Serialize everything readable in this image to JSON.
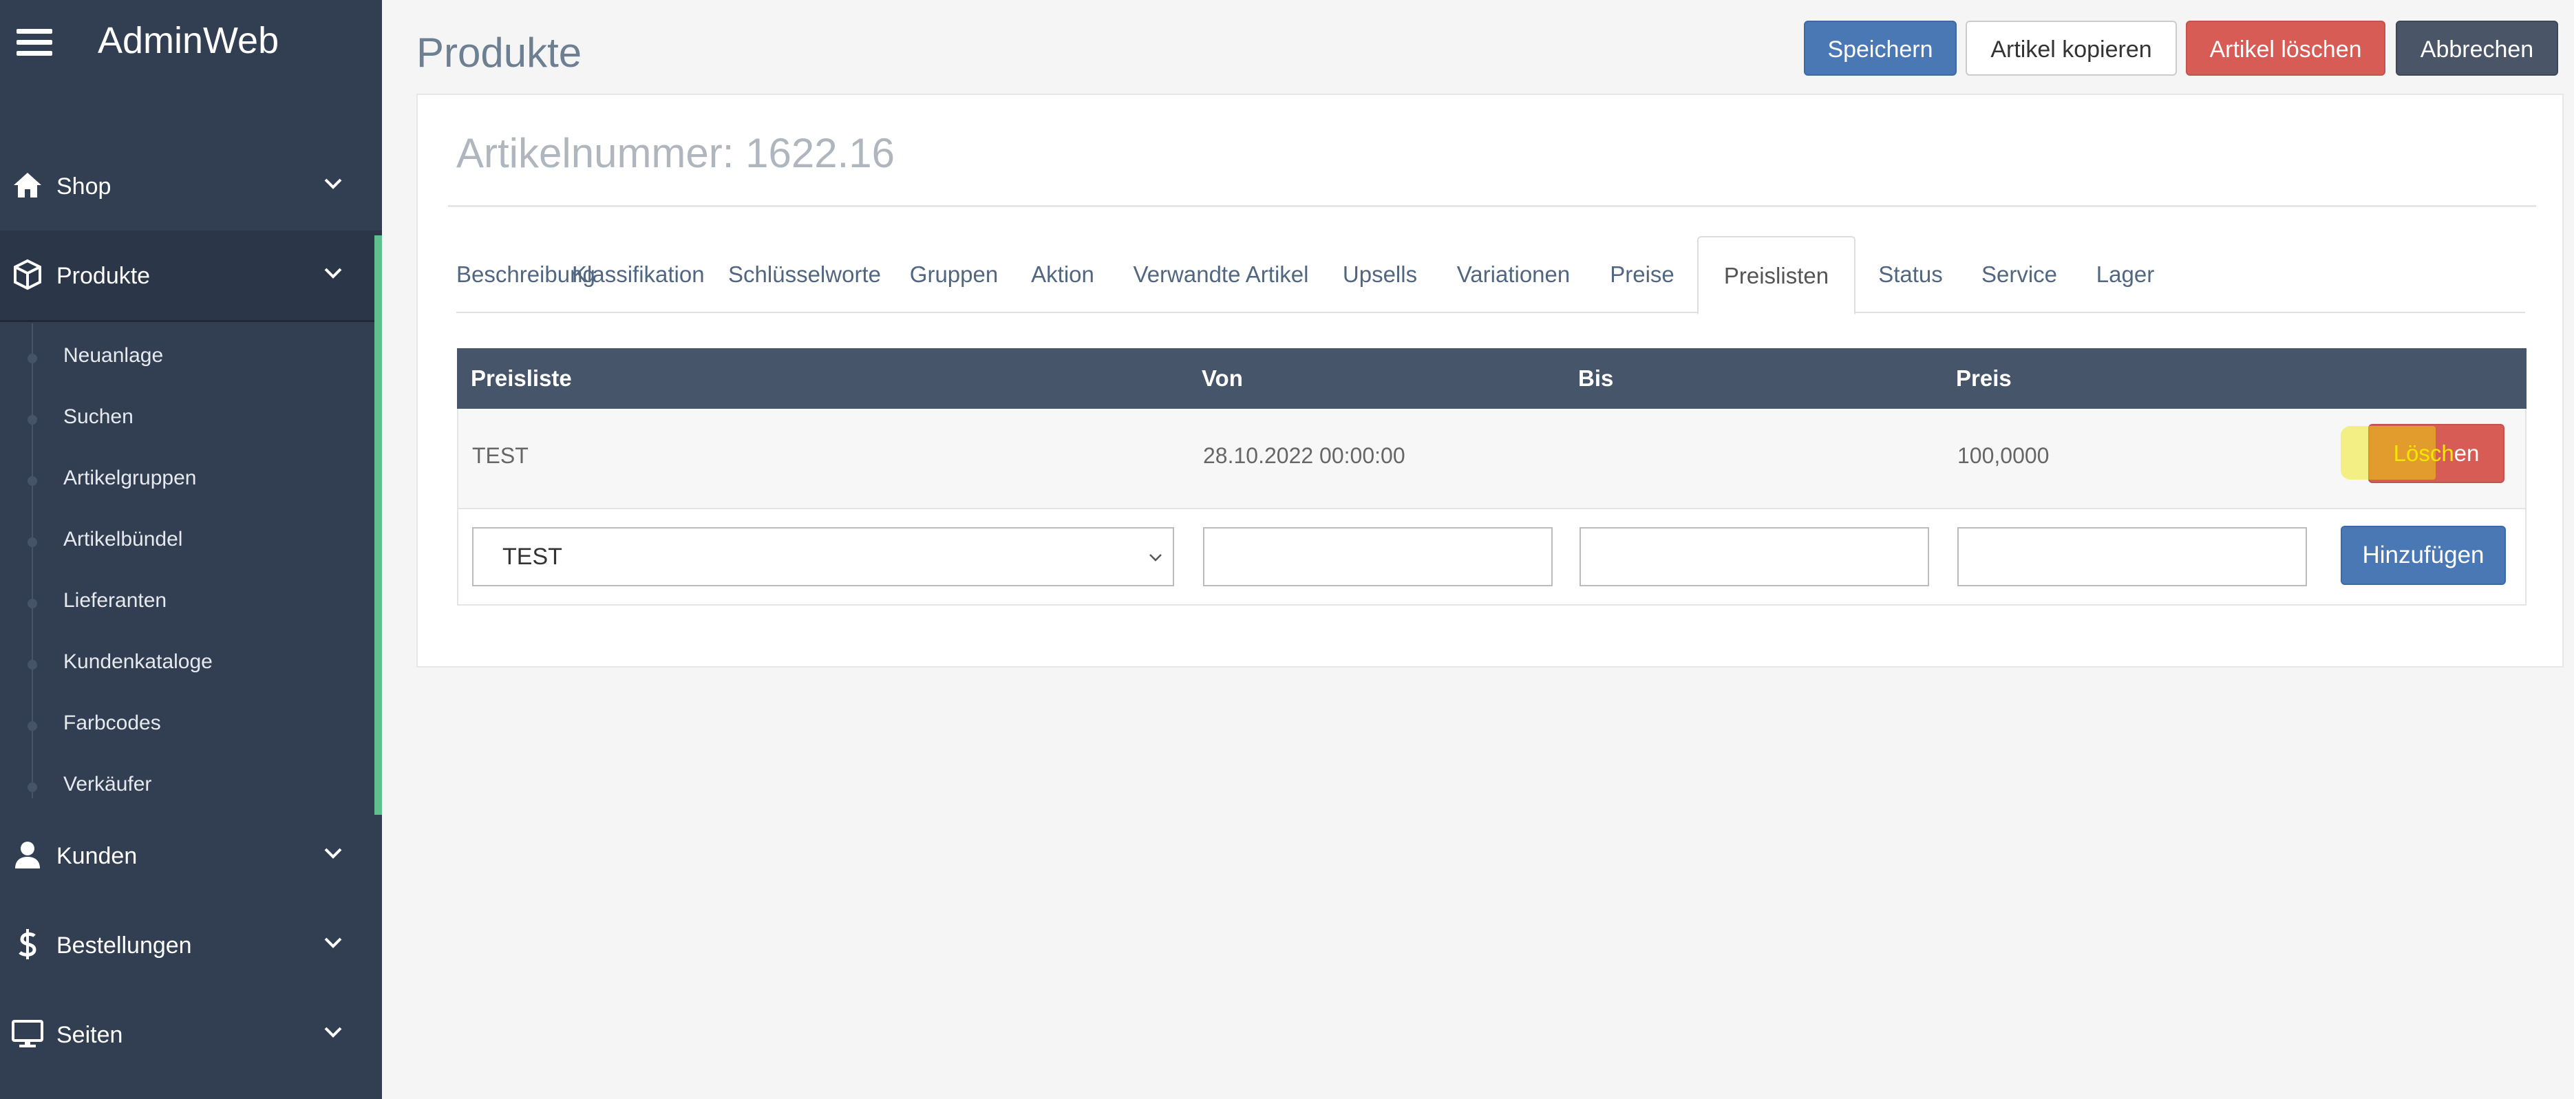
{
  "app": {
    "brand": "AdminWeb"
  },
  "sidebar": {
    "nav": [
      {
        "label": "Shop",
        "icon": "home-icon"
      },
      {
        "label": "Produkte",
        "icon": "cube-icon"
      },
      {
        "label": "Kunden",
        "icon": "user-icon"
      },
      {
        "label": "Bestellungen",
        "icon": "dollar-icon"
      },
      {
        "label": "Seiten",
        "icon": "monitor-icon"
      }
    ],
    "sub_items": [
      {
        "label": "Neuanlage"
      },
      {
        "label": "Suchen"
      },
      {
        "label": "Artikelgruppen"
      },
      {
        "label": "Artikelbündel"
      },
      {
        "label": "Lieferanten"
      },
      {
        "label": "Kundenkataloge"
      },
      {
        "label": "Farbcodes"
      },
      {
        "label": "Verkäufer"
      }
    ],
    "accent_color": "#5fbf8f"
  },
  "page": {
    "title": "Produkte"
  },
  "toolbar": {
    "save_label": "Speichern",
    "copy_label": "Artikel kopieren",
    "delete_label": "Artikel löschen",
    "cancel_label": "Abbrechen"
  },
  "article": {
    "number_label": "Artikelnummer: 1622.16"
  },
  "tabs": [
    {
      "label": "Beschreibung"
    },
    {
      "label": "Klassifikation"
    },
    {
      "label": "Schlüsselworte"
    },
    {
      "label": "Gruppen"
    },
    {
      "label": "Aktion"
    },
    {
      "label": "Verwandte Artikel"
    },
    {
      "label": "Upsells"
    },
    {
      "label": "Variationen"
    },
    {
      "label": "Preise"
    },
    {
      "label": "Preislisten",
      "active": true
    },
    {
      "label": "Status"
    },
    {
      "label": "Service"
    },
    {
      "label": "Lager"
    }
  ],
  "table": {
    "headers": [
      "Preisliste",
      "Von",
      "Bis",
      "Preis"
    ],
    "rows": [
      {
        "preisliste": "TEST",
        "von": "28.10.2022 00:00:00",
        "bis": "",
        "preis": "100,0000",
        "delete_label_a": "Lösch",
        "delete_label_b": "en"
      }
    ],
    "new_row": {
      "select_value": "TEST",
      "von_value": "",
      "bis_value": "",
      "preis_value": "",
      "add_label": "Hinzufügen"
    }
  },
  "colors": {
    "primary": "#4a78b5",
    "danger": "#d65c55",
    "dark": "#4a5567",
    "sidebar": "#323f52",
    "table_header": "#47556a",
    "highlight": "#f0e600"
  }
}
